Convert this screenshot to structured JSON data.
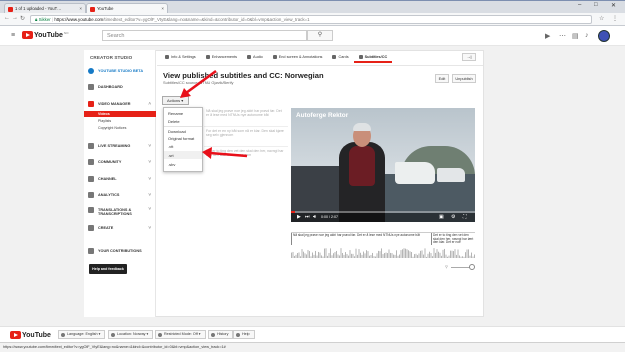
{
  "browser": {
    "tabs": [
      {
        "label": "1 of 1 uploaded - YouT…",
        "active": false
      },
      {
        "label": "YouTube",
        "active": true
      }
    ],
    "address": {
      "secure_label": "Sikker",
      "host": "https://www.youtube.com",
      "path": "/timedtext_editor?v=ygOlF_VtyE&lang=no&name=&kind=&contributor_id=0&bl=vmp&action_view_track=1"
    },
    "window_controls": [
      "–",
      "□",
      "✕"
    ]
  },
  "masthead": {
    "logo_text": "YouTube",
    "logo_suffix": "NO",
    "search_placeholder": "Search",
    "icons": [
      "camera-icon",
      "apps-icon",
      "chat-icon",
      "bell-icon"
    ]
  },
  "sidebar": {
    "title": "CREATOR STUDIO",
    "items": [
      {
        "label": "YOUTUBE STUDIO BETA",
        "icon": "studio-beta-icon",
        "style": "blue"
      },
      {
        "label": "DASHBOARD",
        "icon": "dashboard-icon"
      },
      {
        "label": "VIDEO MANAGER",
        "icon": "video-manager-icon",
        "style": "red",
        "expanded": true
      }
    ],
    "subitems": [
      {
        "label": "Videos",
        "selected": true
      },
      {
        "label": "Playlists"
      },
      {
        "label": "Copyright Notices"
      }
    ],
    "items2": [
      {
        "label": "LIVE STREAMING",
        "icon": "live-icon"
      },
      {
        "label": "COMMUNITY",
        "icon": "community-icon"
      },
      {
        "label": "CHANNEL",
        "icon": "channel-icon"
      },
      {
        "label": "ANALYTICS",
        "icon": "analytics-icon"
      },
      {
        "label": "TRANSLATIONS & TRANSCRIPTIONS",
        "icon": "translations-icon"
      },
      {
        "label": "CREATE",
        "icon": "create-icon"
      },
      {
        "label": "YOUR CONTRIBUTIONS",
        "icon": "contributions-icon"
      }
    ],
    "help_button": "Help and feedback"
  },
  "editor_tabs": [
    {
      "label": "Info & Settings",
      "icon": "pencil-icon"
    },
    {
      "label": "Enhancements",
      "icon": "wand-icon"
    },
    {
      "label": "Audio",
      "icon": "music-icon"
    },
    {
      "label": "End screen & Annotations",
      "icon": "endscreen-icon"
    },
    {
      "label": "Cards",
      "icon": "info-icon"
    },
    {
      "label": "Subtitles/CC",
      "icon": "cc-icon",
      "selected": true
    }
  ],
  "next_button": "→|",
  "heading": "View published subtitles and CC: Norwegian",
  "subheading": "Subtitles/CC source: NTNU Gjøvik/Berify",
  "edit_button": "Edit",
  "unpublish_button": "Unpublish",
  "actions_button": "Actions",
  "actions_menu": [
    "Rename",
    "Delete",
    "Download",
    "Original format",
    ".vtt",
    ".srt",
    ".sbv"
  ],
  "caption_lines": [
    "Nå skal jeg prøve noe jeg aldri har prøvd før. Det er å lese med NTNUs nye autonome båt",
    "For det er en ny båt som nå er klar. Den skal kjøre seg selv gjennom",
    "Det er to ting den vet den skal den her, navngi har lært den klar. Det er noe som"
  ],
  "video": {
    "title": "Autoferge Rektor",
    "time_current": "0:00",
    "time_total": "2:07",
    "progress_pct": 2
  },
  "timeline_segments": [
    "Nå skal jeg prøve noe jeg aldri har prøvd før. Det er å lese med NTNUs nye autonome båt",
    "Det er to ting den vet den skal den her, navngi har lært den klar. Det er noe"
  ],
  "footer": {
    "logo_text": "YouTube",
    "language": "Language: English",
    "location": "Location: Norway",
    "restricted": "Restricted Mode: Off",
    "history": "History",
    "help": "Help"
  },
  "status_url": "https://www.youtube.com/timedtext_editor?v=ygOlF_VtyE&lang=no&name=&kind=&contributor_id=0&bl=vmp&action_view_track=1#"
}
